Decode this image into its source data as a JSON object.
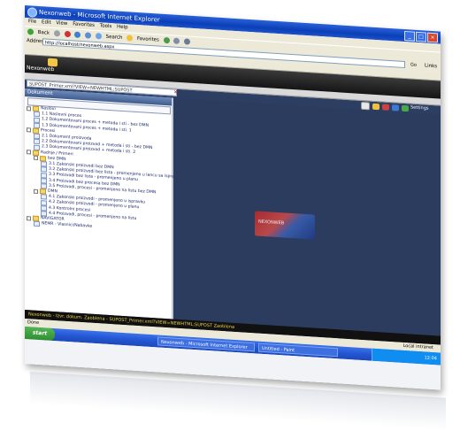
{
  "window": {
    "title": "Nexonweb - Microsoft Internet Explorer"
  },
  "menubar": {
    "items": [
      "File",
      "Edit",
      "View",
      "Favorites",
      "Tools",
      "Help"
    ]
  },
  "toolbar": {
    "back_label": "Back",
    "search_label": "Search",
    "favorites_label": "Favorites"
  },
  "addressbar": {
    "label": "Address",
    "url": "http://localhost/nexonweb.aspx",
    "go_label": "Go",
    "links_label": "Links"
  },
  "app": {
    "name": "Nexonweb",
    "url_field": "SUPOST_Primer.xml?VIEW=NEWHTML;SUPOST",
    "settings_label": "Settings"
  },
  "tree": {
    "header": "Dokument",
    "items": [
      {
        "level": 0,
        "kind": "folder",
        "text": "Naslovi"
      },
      {
        "level": 1,
        "kind": "doc",
        "text": "1.1 Naslovni proces"
      },
      {
        "level": 1,
        "kind": "doc",
        "text": "1.2 Dokumentovani proces + metoda i sti - bez DMN"
      },
      {
        "level": 1,
        "kind": "doc",
        "text": "1.3 Dokumentovani proces + metoda i sti. 1"
      },
      {
        "level": 0,
        "kind": "folder",
        "text": "Procesi"
      },
      {
        "level": 1,
        "kind": "doc",
        "text": "2.1 Dokument proizvoda"
      },
      {
        "level": 1,
        "kind": "doc",
        "text": "2.2 Dokumentovani proizvod + metoda i sti - bez DMN"
      },
      {
        "level": 1,
        "kind": "doc",
        "text": "2.3 Dokumentovani proizvod + metoda i sti. 2"
      },
      {
        "level": 0,
        "kind": "folder",
        "text": "Radnje / Primeri"
      },
      {
        "level": 1,
        "kind": "folder",
        "text": "bez DMN"
      },
      {
        "level": 2,
        "kind": "doc",
        "text": "3.1 Zakonski proizvodi bez DMN"
      },
      {
        "level": 2,
        "kind": "doc",
        "text": "3.2 Zakonski proizvodi bez lista - promenjeno u lancu sa ispravkom"
      },
      {
        "level": 2,
        "kind": "doc",
        "text": "3.3 Proizvodi bez lista - promenjeno u planu"
      },
      {
        "level": 2,
        "kind": "doc",
        "text": "3.4 Proizvodi bez procesa bez DMN"
      },
      {
        "level": 2,
        "kind": "doc",
        "text": "3.5 Proizvodi, procesi - promenjeno na listu bez DMN"
      },
      {
        "level": 1,
        "kind": "folder",
        "text": "DMN"
      },
      {
        "level": 2,
        "kind": "doc",
        "text": "4.1 Zakonski proizvodi - promenjeno u ispravku"
      },
      {
        "level": 2,
        "kind": "doc",
        "text": "4.2 Zakonski proizvodi - promenjeno u planu"
      },
      {
        "level": 2,
        "kind": "doc",
        "text": "4.3 Kontrolni procesi"
      },
      {
        "level": 2,
        "kind": "doc",
        "text": "4.4 Proizvodi, procesi - promenjeno na listu"
      },
      {
        "level": 0,
        "kind": "folder",
        "text": "NAVIGATOR"
      },
      {
        "level": 1,
        "kind": "doc",
        "text": "NEMR - Vlasnici/Nabavke"
      }
    ]
  },
  "content": {
    "logo_text": "NEXONWEB"
  },
  "statusbar": {
    "app_status": "Nexonweb - Izvr. dokum.   Zaoblena - SUPOST_Primer.xml?VIEW=NEWHTML;SUPOST   Zaoblena",
    "ie_status": "Done",
    "zone": "Local intranet"
  },
  "taskbar": {
    "start_label": "start",
    "tasks": [
      "Nexonweb - Microsoft Internet Explorer",
      "Untitled - Paint"
    ],
    "clock": "12:04"
  }
}
